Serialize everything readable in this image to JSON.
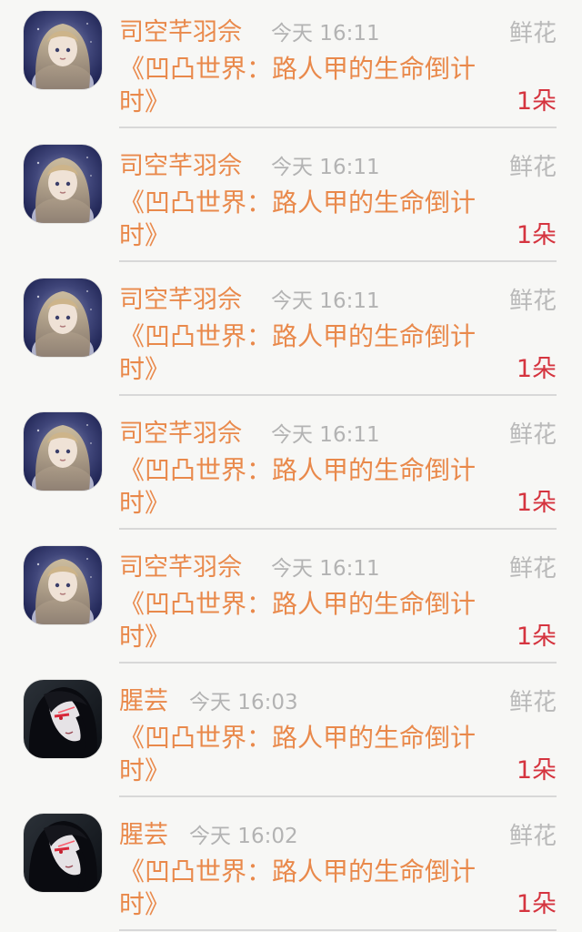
{
  "colors": {
    "accent_orange": "#e9894b",
    "count_red": "#d5343f",
    "muted_gray": "#b3b3b3",
    "background": "#f7f7f5"
  },
  "records": [
    {
      "user": "司空芊羽佘",
      "time": "今天 16:11",
      "gift_type": "鲜花",
      "book_title": "《凹凸世界：路人甲的生命倒计时》",
      "count": "1朵",
      "avatar": "anime-girl-avatar"
    },
    {
      "user": "司空芊羽佘",
      "time": "今天 16:11",
      "gift_type": "鲜花",
      "book_title": "《凹凸世界：路人甲的生命倒计时》",
      "count": "1朵",
      "avatar": "anime-girl-avatar"
    },
    {
      "user": "司空芊羽佘",
      "time": "今天 16:11",
      "gift_type": "鲜花",
      "book_title": "《凹凸世界：路人甲的生命倒计时》",
      "count": "1朵",
      "avatar": "anime-girl-avatar"
    },
    {
      "user": "司空芊羽佘",
      "time": "今天 16:11",
      "gift_type": "鲜花",
      "book_title": "《凹凸世界：路人甲的生命倒计时》",
      "count": "1朵",
      "avatar": "anime-girl-avatar"
    },
    {
      "user": "司空芊羽佘",
      "time": "今天 16:11",
      "gift_type": "鲜花",
      "book_title": "《凹凸世界：路人甲的生命倒计时》",
      "count": "1朵",
      "avatar": "anime-girl-avatar"
    },
    {
      "user": "腥芸",
      "time": "今天 16:03",
      "gift_type": "鲜花",
      "book_title": "《凹凸世界：路人甲的生命倒计时》",
      "count": "1朵",
      "avatar": "dark-hair-avatar"
    },
    {
      "user": "腥芸",
      "time": "今天 16:02",
      "gift_type": "鲜花",
      "book_title": "《凹凸世界：路人甲的生命倒计时》",
      "count": "1朵",
      "avatar": "dark-hair-avatar"
    }
  ]
}
